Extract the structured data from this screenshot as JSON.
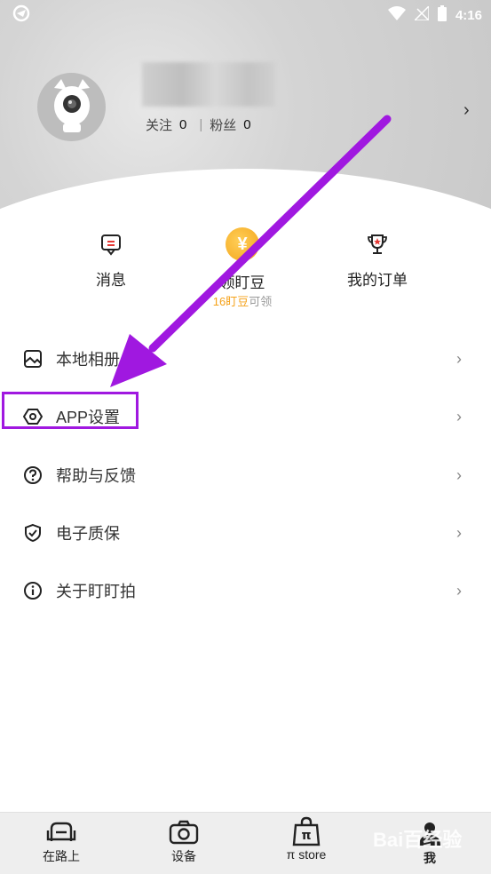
{
  "status": {
    "time": "4:16"
  },
  "profile": {
    "following_label": "关注",
    "following_count": "0",
    "fans_label": "粉丝",
    "fans_count": "0"
  },
  "quick": [
    {
      "label": "消息"
    },
    {
      "label": "领盯豆",
      "coin_symbol": "¥",
      "sub_highlight": "16盯豆",
      "sub_suffix": "可领"
    },
    {
      "label": "我的订单"
    }
  ],
  "menu": [
    {
      "label": "本地相册"
    },
    {
      "label": "APP设置"
    },
    {
      "label": "帮助与反馈"
    },
    {
      "label": "电子质保"
    },
    {
      "label": "关于盯盯拍"
    }
  ],
  "tabs": [
    {
      "label": "在路上"
    },
    {
      "label": "设备"
    },
    {
      "label": "π store"
    },
    {
      "label": "我"
    }
  ],
  "watermark": "Bai百经验",
  "colors": {
    "highlight": "#a018e0",
    "coin": "#f3a41a"
  }
}
